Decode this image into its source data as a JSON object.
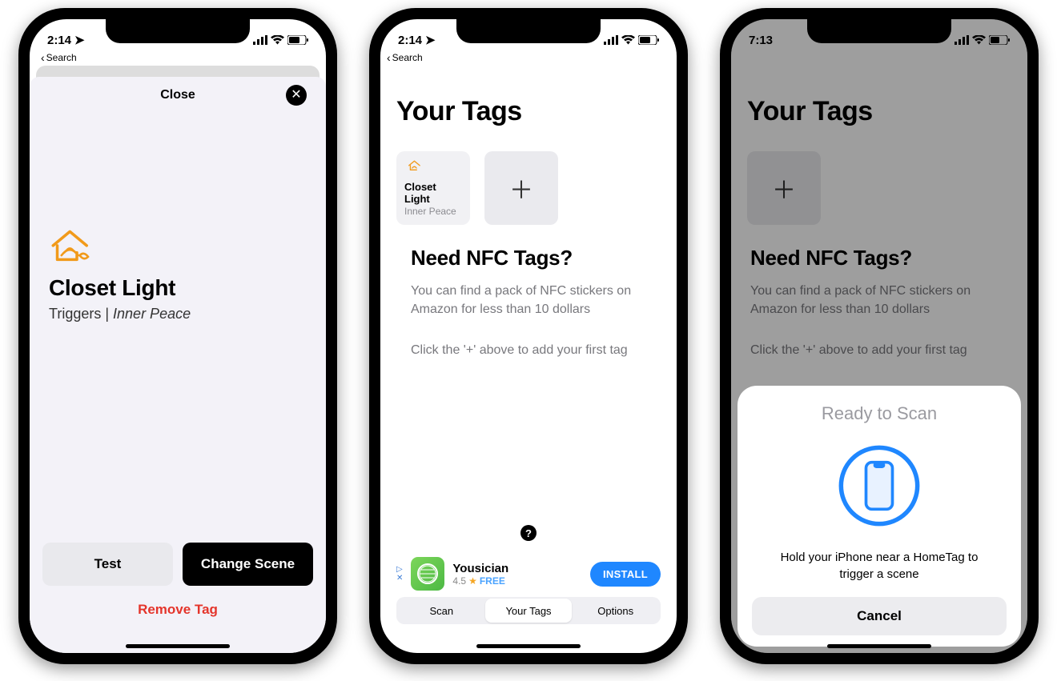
{
  "s1": {
    "status": {
      "time": "2:14",
      "back": "Search",
      "showLoc": true
    },
    "closeLabel": "Close",
    "title": "Closet Light",
    "triggersPrefix": "Triggers | ",
    "sceneName": "Inner Peace",
    "testBtn": "Test",
    "changeBtn": "Change Scene",
    "removeBtn": "Remove Tag"
  },
  "s2": {
    "status": {
      "time": "2:14",
      "back": "Search",
      "showLoc": true
    },
    "heading": "Your Tags",
    "tag": {
      "title": "Closet Light",
      "sub": "Inner Peace"
    },
    "needHeading": "Need NFC Tags?",
    "p1": "You can find a pack of NFC stickers on Amazon for less than 10 dollars",
    "p2": "Click the '+' above to add your first tag",
    "ad": {
      "title": "Yousician",
      "rating": "4.5",
      "price": "FREE",
      "cta": "INSTALL"
    },
    "tabs": [
      "Scan",
      "Your Tags",
      "Options"
    ],
    "activeTab": 1
  },
  "s3": {
    "status": {
      "time": "7:13",
      "showLoc": false
    },
    "heading": "Your Tags",
    "needHeading": "Need NFC Tags?",
    "p1": "You can find a pack of NFC stickers on Amazon for less than 10 dollars",
    "p2": "Click the '+' above to add your first tag",
    "sheet": {
      "title": "Ready to Scan",
      "msg": "Hold your iPhone near a HomeTag to trigger a scene",
      "cancel": "Cancel"
    }
  }
}
